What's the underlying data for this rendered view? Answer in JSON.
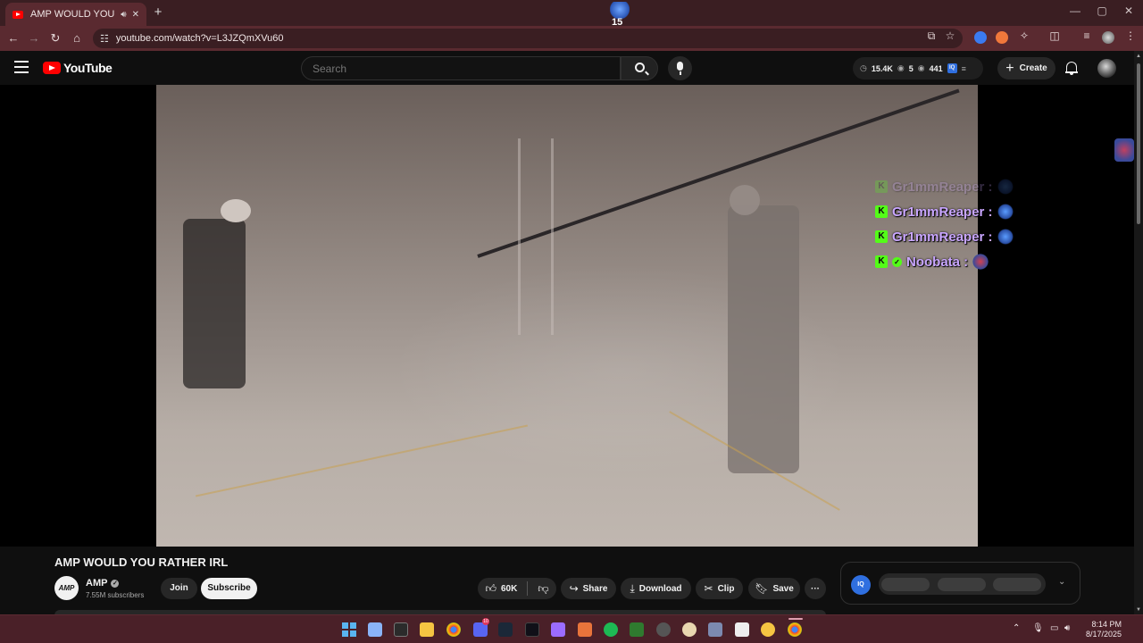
{
  "browser": {
    "tab_title": "AMP WOULD YOU RATHER",
    "tab_audio_icon": "speaker-icon",
    "tab_close": "✕",
    "new_tab": "+",
    "address": "youtube.com/watch?v=L3JZQmXVu60",
    "tab_ext_label": "15",
    "window_controls": [
      "—",
      "▢",
      "✕"
    ]
  },
  "youtube": {
    "logo_text": "YouTube",
    "search_placeholder": "Search",
    "stats": {
      "views": "15.4K",
      "likes": "5",
      "watching": "441",
      "iq_label": "IQ"
    },
    "create_label": "Create"
  },
  "chat": {
    "faded_user": "Gr1mmReaper :",
    "messages": [
      {
        "user": "Gr1mmReaper :",
        "badge": "K",
        "verified": false
      },
      {
        "user": "Gr1mmReaper :",
        "badge": "K",
        "verified": false
      },
      {
        "user": "Noobata :",
        "badge": "K",
        "verified": true
      }
    ]
  },
  "video": {
    "title": "AMP WOULD YOU RATHER IRL",
    "channel": {
      "name": "AMP",
      "avatar_text": "AMP",
      "subscribers": "7.55M subscribers",
      "join_label": "Join",
      "subscribe_label": "Subscribe"
    },
    "actions": {
      "likes": "60K",
      "share": "Share",
      "download": "Download",
      "clip": "Clip",
      "save": "Save",
      "more": "···"
    },
    "iq_panel_label": "IQ"
  },
  "taskbar": {
    "time": "8:14 PM",
    "date": "8/17/2025",
    "discord_badge": "10"
  },
  "colors": {
    "chrome_tab_bg": "#3a1e22",
    "chrome_toolbar": "#5a2a30",
    "yt_bg": "#0f0f0f",
    "yt_red": "#ff0000",
    "kick_green": "#53fc18",
    "chat_purple": "#c9a6ff"
  }
}
